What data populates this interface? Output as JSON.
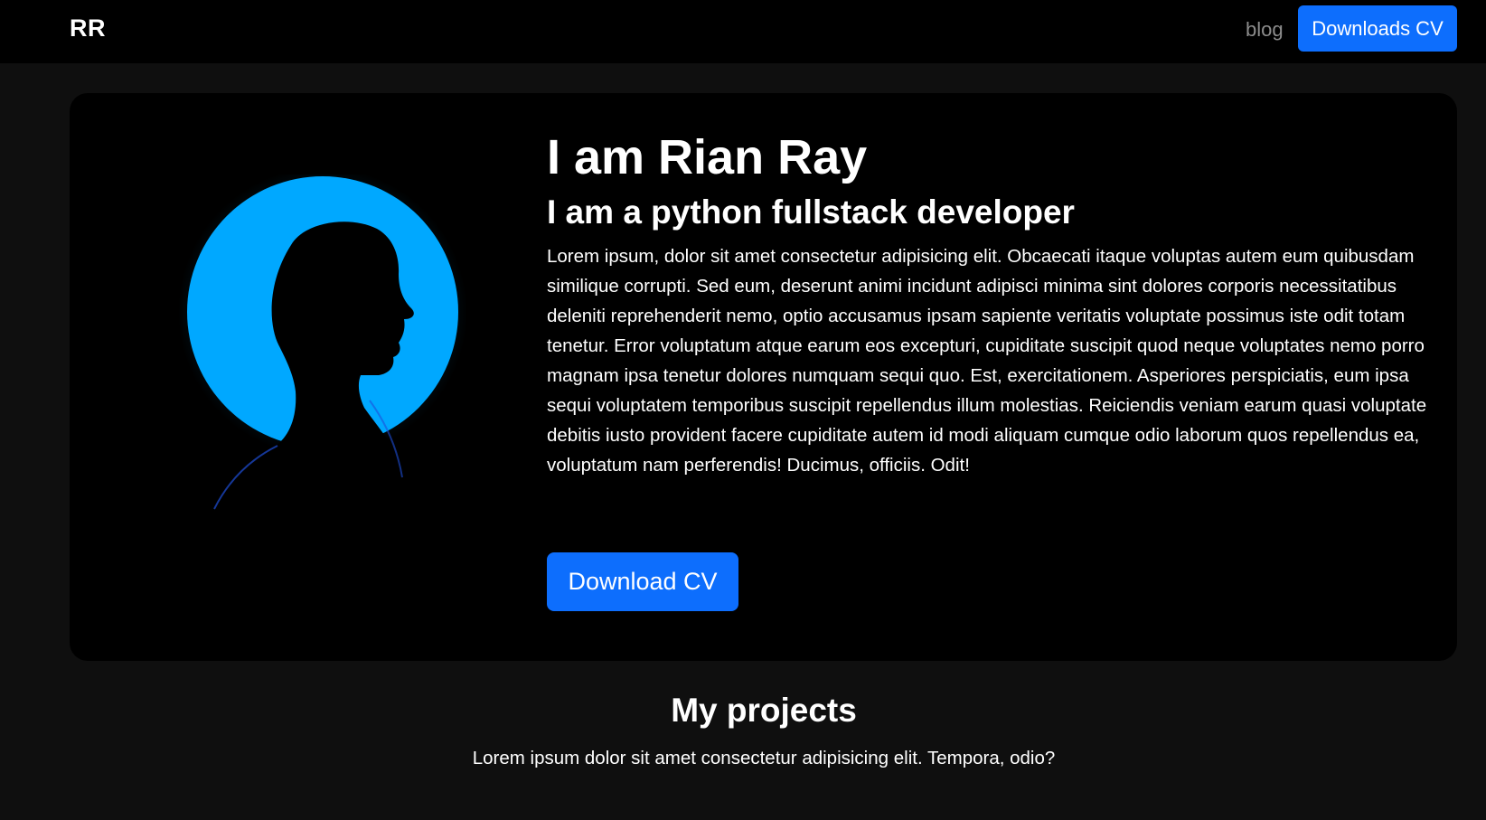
{
  "navbar": {
    "brand": "RR",
    "links": [
      {
        "label": "blog"
      }
    ],
    "cv_button": "Downloads CV"
  },
  "hero": {
    "title": "I am Rian Ray",
    "subtitle": "I am a python fullstack developer",
    "paragraph": "Lorem ipsum, dolor sit amet consectetur adipisicing elit. Obcaecati itaque voluptas autem eum quibusdam similique corrupti. Sed eum, deserunt animi incidunt adipisci minima sint dolores corporis necessitatibus deleniti reprehenderit nemo, optio accusamus ipsam sapiente veritatis voluptate possimus iste odit totam tenetur. Error voluptatum atque earum eos excepturi, cupiditate suscipit quod neque voluptates nemo porro magnam ipsa tenetur dolores numquam sequi quo. Est, exercitationem. Asperiores perspiciatis, eum ipsa sequi voluptatem temporibus suscipit repellendus illum molestias. Reiciendis veniam earum quasi voluptate debitis iusto provident facere cupiditate autem id modi aliquam cumque odio laborum quos repellendus ea, voluptatum nam perferendis! Ducimus, officiis. Odit!",
    "button": "Download CV",
    "image": "silhouette-portrait"
  },
  "projects": {
    "title": "My projects",
    "subtitle": "Lorem ipsum dolor sit amet consectetur adipisicing elit. Tempora, odio?"
  },
  "colors": {
    "page_background": "#0f0f0f",
    "panel_background": "#000000",
    "accent": "#0d6efd",
    "halo": "#00a8ff",
    "muted_link": "#8c8c8c",
    "text": "#ffffff"
  }
}
